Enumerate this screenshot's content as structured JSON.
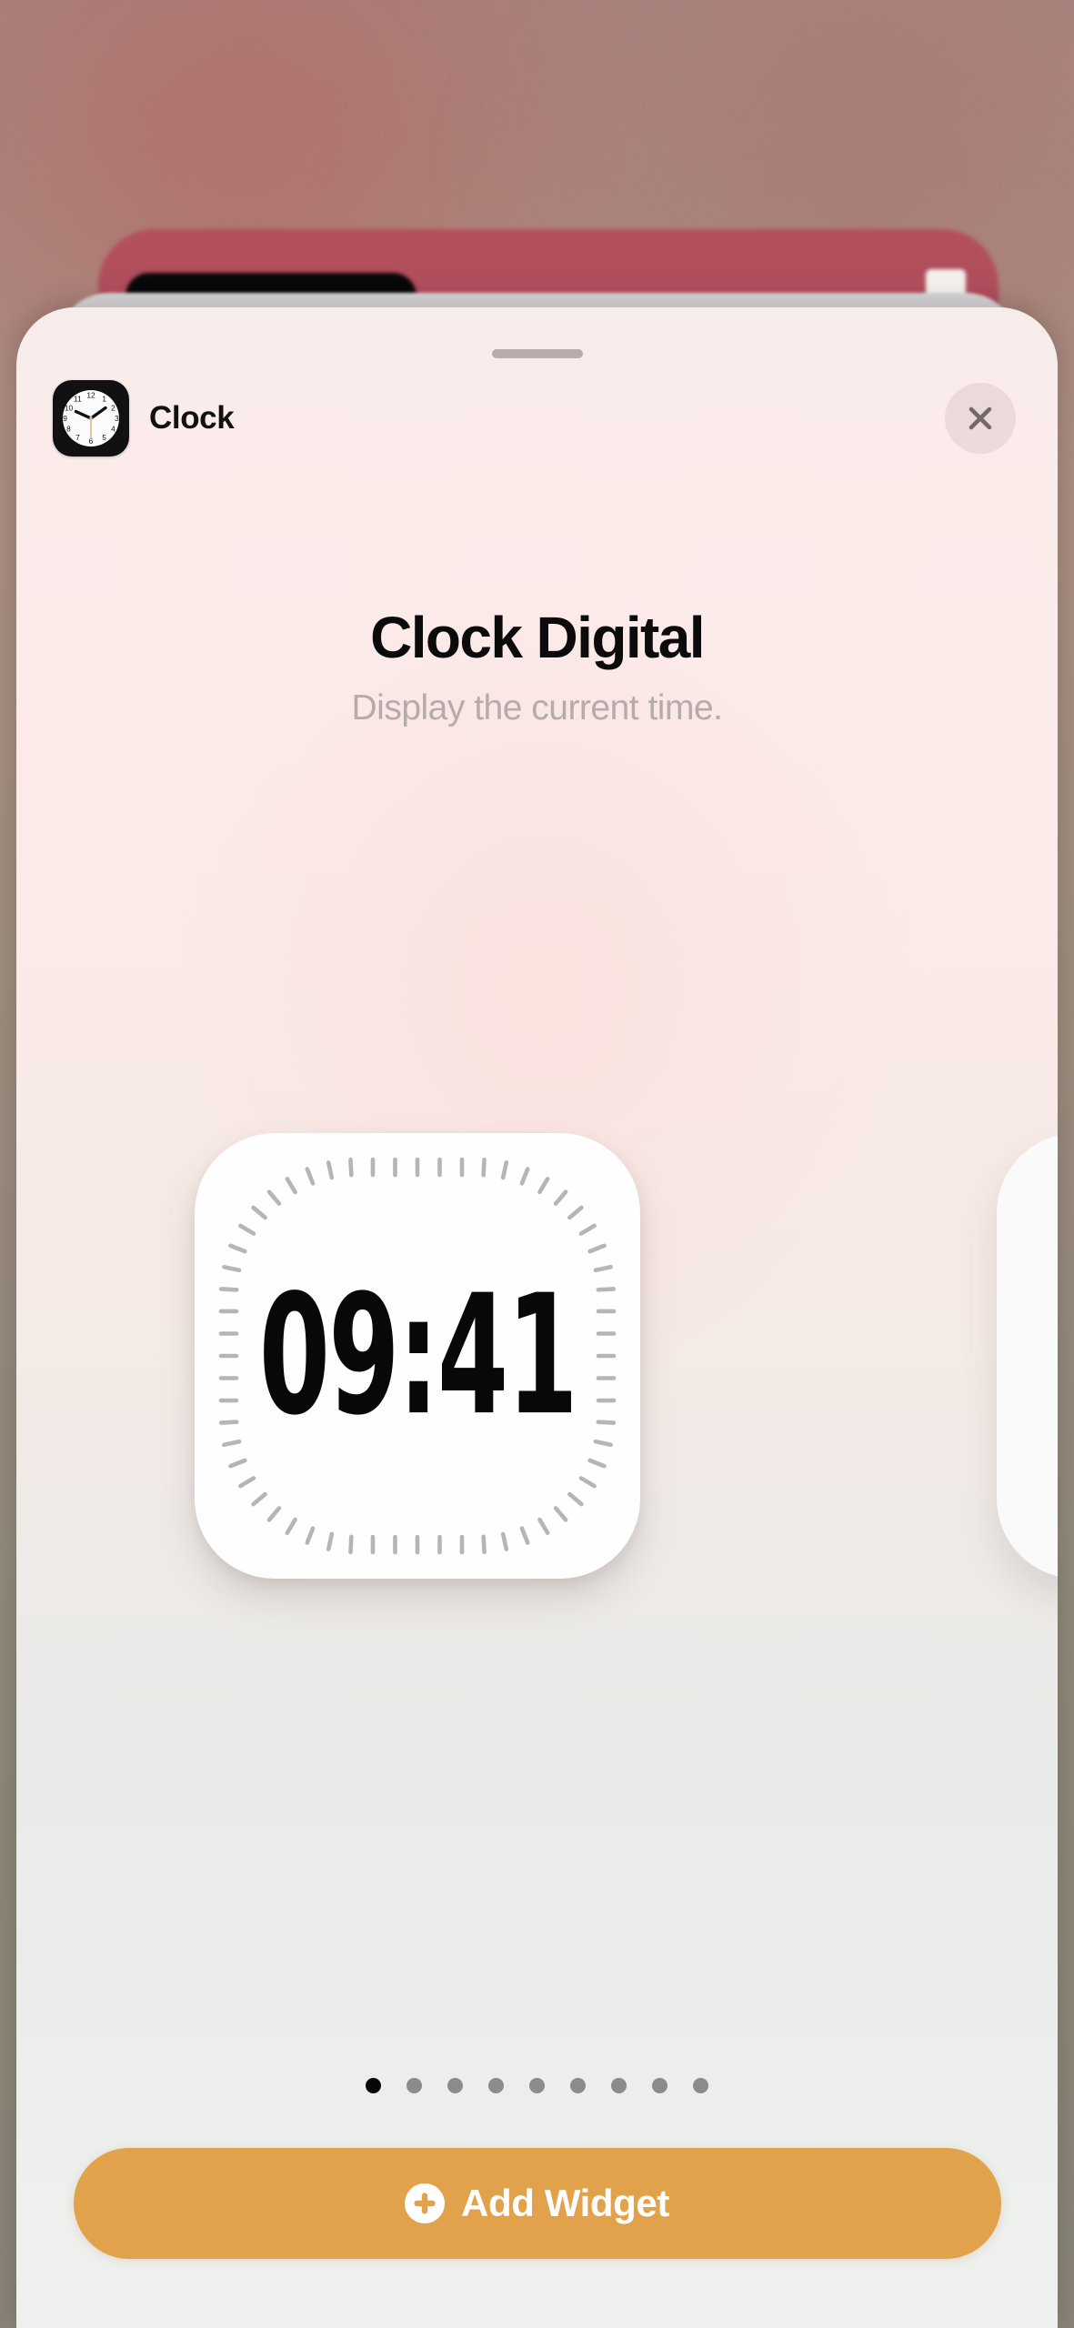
{
  "backdrop": {
    "description": "blurred home screen behind sheet",
    "accent_red": "#b4505c",
    "base_top": "#a9827d",
    "base_bottom": "#888376"
  },
  "sheet": {
    "grabber": "drag-handle",
    "bg_top_color": "#fbeceb",
    "bg_bottom_color": "#eef0ee"
  },
  "header": {
    "app_icon": "clock-app-icon",
    "app_name": "Clock",
    "close_icon": "close-icon"
  },
  "detail": {
    "title": "Clock Digital",
    "subtitle": "Display the current time."
  },
  "preview": {
    "widget_kind": "clock-digital-widget",
    "time": "09:41",
    "tick_count": 60,
    "tick_color": "#9a9a9a",
    "card_color": "#fefefe"
  },
  "pagination": {
    "total": 9,
    "active_index": 0,
    "active_color": "#070707",
    "inactive_color": "#8a8c8a"
  },
  "footer": {
    "add_label": "Add Widget",
    "add_icon": "plus-circle-icon",
    "accent_color": "#e2a24b"
  }
}
